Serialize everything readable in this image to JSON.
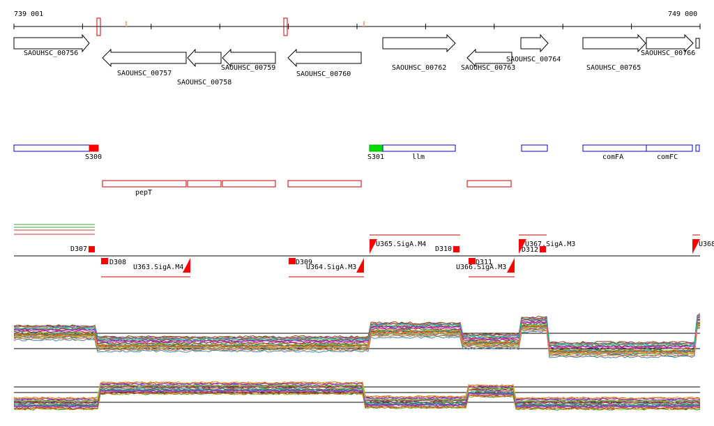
{
  "ruler": {
    "start_label": "739 001",
    "end_label": "749 000"
  },
  "genes": [
    {
      "name": "SAOUHSC_00756",
      "strand": "+"
    },
    {
      "name": "SAOUHSC_00757",
      "strand": "-"
    },
    {
      "name": "SAOUHSC_00758",
      "strand": "-"
    },
    {
      "name": "SAOUHSC_00759",
      "strand": "-"
    },
    {
      "name": "SAOUHSC_00760",
      "strand": "-"
    },
    {
      "name": "SAOUHSC_00762",
      "strand": "+"
    },
    {
      "name": "SAOUHSC_00763",
      "strand": "-"
    },
    {
      "name": "SAOUHSC_00764",
      "strand": "+"
    },
    {
      "name": "SAOUHSC_00765",
      "strand": "+"
    },
    {
      "name": "SAOUHSC_00766",
      "strand": "+"
    }
  ],
  "sense_features": [
    {
      "label": "S300",
      "color": "#ff0000"
    },
    {
      "label": "S301",
      "color": "#00dd00"
    },
    {
      "label": "llm"
    },
    {
      "label": "comFA"
    },
    {
      "label": "comFC"
    }
  ],
  "antisense_features": [
    {
      "label": "pepT"
    }
  ],
  "segments": [
    {
      "label": "D307"
    },
    {
      "label": "D308"
    },
    {
      "label": "U363.SigA.M4"
    },
    {
      "label": "D309"
    },
    {
      "label": "U364.SigA.M3"
    },
    {
      "label": "U365.SigA.M4"
    },
    {
      "label": "D310"
    },
    {
      "label": "D311"
    },
    {
      "label": "U366.SigA.M3"
    },
    {
      "label": "U367.SigA.M3"
    },
    {
      "label": "D312"
    },
    {
      "label": "U368"
    }
  ],
  "colors": {
    "gene_outline": "#000000",
    "feature_outline": "#0000cc",
    "antisense_outline": "#cc0000",
    "segment_marker": "#ff0000"
  }
}
